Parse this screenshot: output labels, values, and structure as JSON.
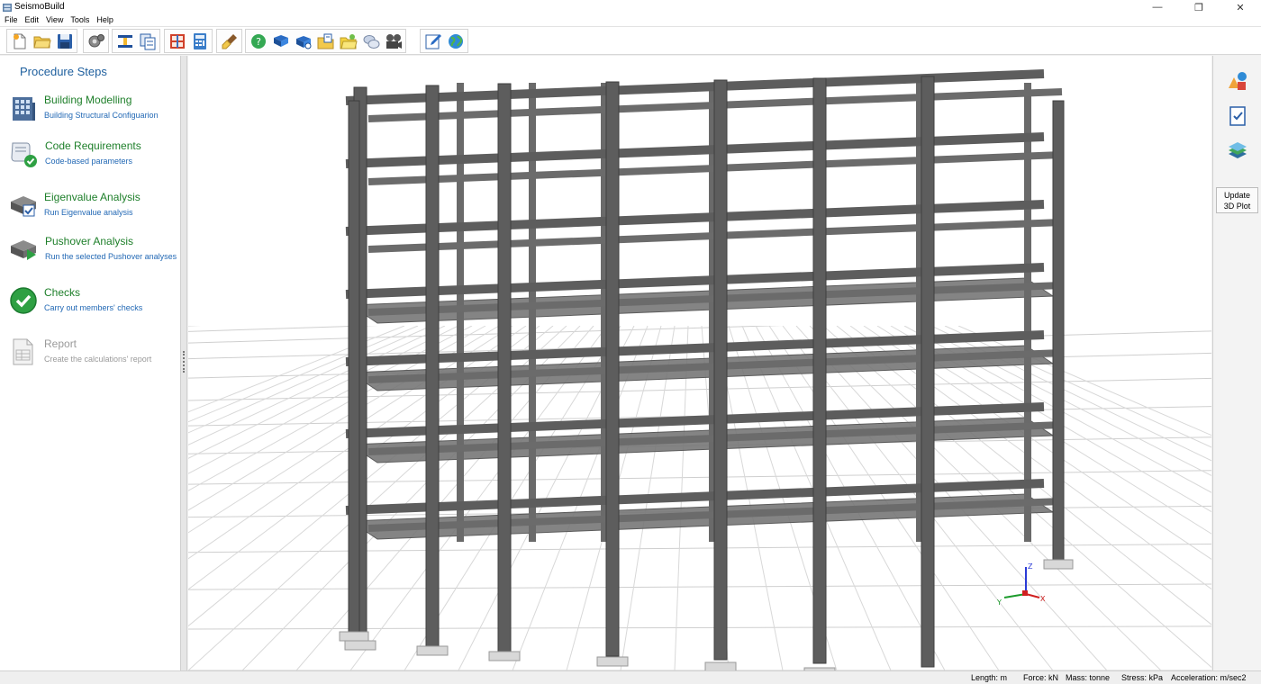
{
  "window": {
    "title": "SeismoBuild",
    "min_glyph": "—",
    "restore_glyph": "❐",
    "close_glyph": "✕"
  },
  "menu": [
    "File",
    "Edit",
    "View",
    "Tools",
    "Help"
  ],
  "toolbar": {
    "groups": [
      [
        "new-file-icon",
        "open-folder-icon",
        "save-disk-icon"
      ],
      [
        "settings-gears-icon"
      ],
      [
        "beam-section-icon",
        "copy-sections-icon"
      ],
      [
        "frame-model-icon",
        "calculator-icon"
      ],
      [
        "brush-clean-icon"
      ],
      [
        "help-icon",
        "book-manual-icon",
        "book-guide-icon",
        "folder-docs-icon",
        "folder-examples-icon",
        "speech-bubbles-icon",
        "film-video-icon"
      ],
      [
        "edit-pencil-icon",
        "globe-web-icon"
      ]
    ]
  },
  "left_panel": {
    "title": "Procedure Steps",
    "steps": [
      {
        "title": "Building Modelling",
        "desc": "Building Structural Configuarion",
        "icon": "building-icon",
        "enabled": true
      },
      {
        "title": "Code Requirements",
        "desc": "Code-based parameters",
        "icon": "scroll-check-icon",
        "enabled": true
      },
      {
        "title": "Eigenvalue Analysis",
        "desc": "Run Eigenvalue analysis",
        "icon": "machine-check-icon",
        "enabled": true
      },
      {
        "title": "Pushover Analysis",
        "desc": "Run the selected Pushover analyses",
        "icon": "machine-play-icon",
        "enabled": true
      },
      {
        "title": "Checks",
        "desc": "Carry out members' checks",
        "icon": "green-check-icon",
        "enabled": true
      },
      {
        "title": "Report",
        "desc": "Create the calculations' report",
        "icon": "report-document-icon",
        "enabled": false
      }
    ]
  },
  "right_panel": {
    "icons": [
      "shapes-3d-icon",
      "checklist-icon",
      "layers-icon"
    ],
    "update_label_1": "Update",
    "update_label_2": "3D Plot"
  },
  "axes": {
    "x": "X",
    "y": "Y",
    "z": "Z"
  },
  "statusbar": {
    "length": "Length: m",
    "force": "Force: kN",
    "mass": "Mass: tonne",
    "stress": "Stress: kPa",
    "acceleration": "Acceleration: m/sec2"
  },
  "colors": {
    "steps_title": "#1e5f9e",
    "step_title_green": "#1e7f2a",
    "step_desc_blue": "#2369b5",
    "structure_gray": "#5d5d5d"
  }
}
